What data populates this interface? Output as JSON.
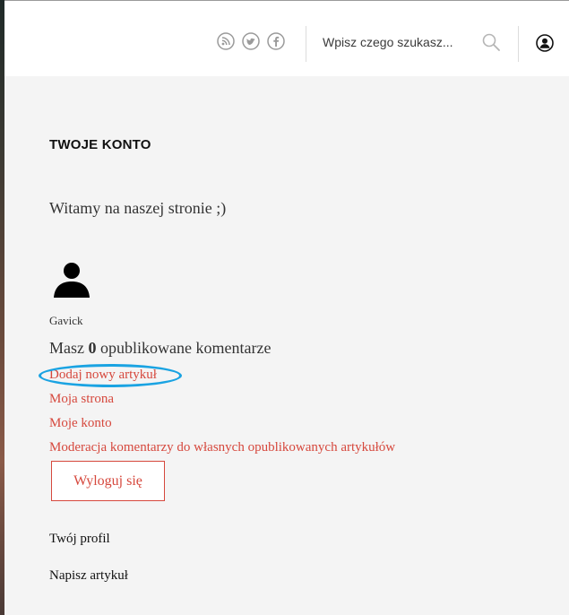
{
  "header": {
    "social": [
      {
        "name": "rss-icon"
      },
      {
        "name": "twitter-icon"
      },
      {
        "name": "facebook-icon"
      }
    ],
    "search": {
      "placeholder": "Wpisz czego szukasz..."
    }
  },
  "account": {
    "title": "TWOJE KONTO",
    "welcome": "Witamy na naszej stronie ;)",
    "username": "Gavick",
    "comments": {
      "prefix": "Masz ",
      "count": "0",
      "suffix": " opublikowane komentarze"
    },
    "links": [
      {
        "label": "Dodaj nowy artykuł"
      },
      {
        "label": "Moja strona"
      },
      {
        "label": "Moje konto"
      },
      {
        "label": "Moderacja komentarzy do własnych opublikowanych artykułów"
      }
    ],
    "logout_label": "Wyloguj się",
    "profile_links": [
      {
        "label": "Twój profil"
      },
      {
        "label": "Napisz artykuł"
      }
    ]
  },
  "colors": {
    "accent": "#d6483d",
    "highlight": "#1aa3e2",
    "page_bg": "#f4f4f4",
    "header_bg": "#ffffff"
  }
}
